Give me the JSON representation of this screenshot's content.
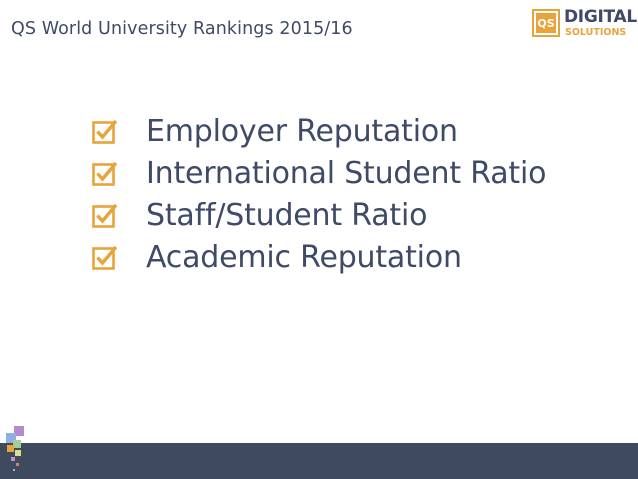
{
  "header": {
    "title": "QS World University Rankings 2015/16"
  },
  "logo": {
    "mark": "QS",
    "word1": "DIGITAL",
    "word2": "SOLUTIONS"
  },
  "criteria": [
    {
      "label": "Employer Reputation",
      "checked": true
    },
    {
      "label": "International Student Ratio",
      "checked": true
    },
    {
      "label": "Staff/Student Ratio",
      "checked": true
    },
    {
      "label": "Academic Reputation",
      "checked": true
    }
  ],
  "colors": {
    "text": "#3f4a66",
    "accent": "#e8a33a",
    "footer": "#3f4a5e"
  },
  "icons": {
    "checkbox": "checked-box-icon"
  }
}
